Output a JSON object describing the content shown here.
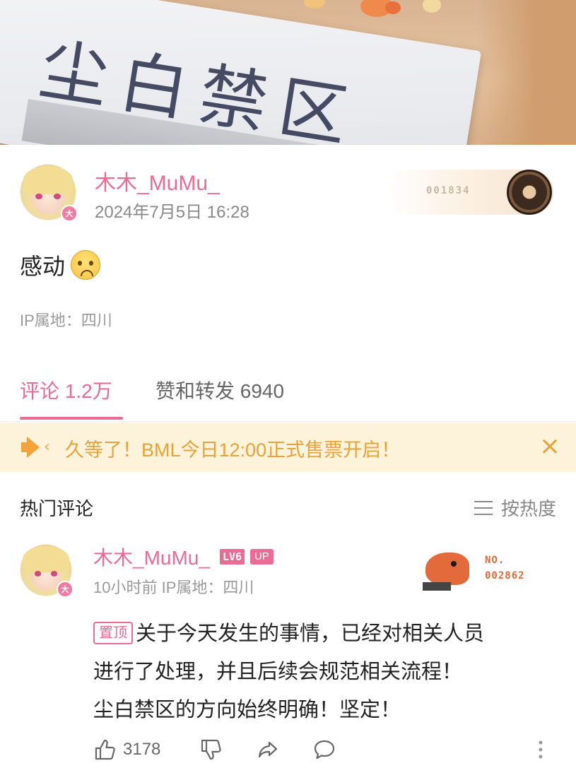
{
  "banner": {
    "sign_text": "尘白禁区",
    "sign_text_partial": "*",
    "image_desc": "acrylic-sign-banner"
  },
  "post": {
    "username": "木木_MuMu_",
    "timestamp": "2024年7月5日 16:28",
    "fan_badge_number": "001834",
    "avatar_badge": "大",
    "text": "感动",
    "emoji": "sad-face-emoji",
    "ip_location": "IP属地：四川"
  },
  "tabs": [
    {
      "label": "评论 1.2万",
      "active": true
    },
    {
      "label": "赞和转发 6940",
      "active": false
    }
  ],
  "notice": {
    "message": "久等了！BML今日12:00正式售票开启！",
    "icon": "speaker-icon",
    "close_glyph": "×"
  },
  "comments_section": {
    "title": "热门评论",
    "sort_label": "按热度"
  },
  "comment": {
    "username": "木木_MuMu_",
    "level_badge": "LV6",
    "up_badge": "UP",
    "meta": "10小时前  IP属地：四川",
    "avatar_badge": "大",
    "decoration_label": "NO.",
    "decoration_number": "002862",
    "pin_tag": "置顶",
    "lines": [
      "关于今天发生的事情，已经对相关人员",
      "进行了处理，并且后续会规范相关流程！",
      "尘白禁区的方向始终明确！坚定！"
    ],
    "like_count": "3178"
  },
  "colors": {
    "accent_pink": "#ec6b95",
    "notice_bg": "#fdf3da",
    "notice_text": "#e8a23a"
  }
}
